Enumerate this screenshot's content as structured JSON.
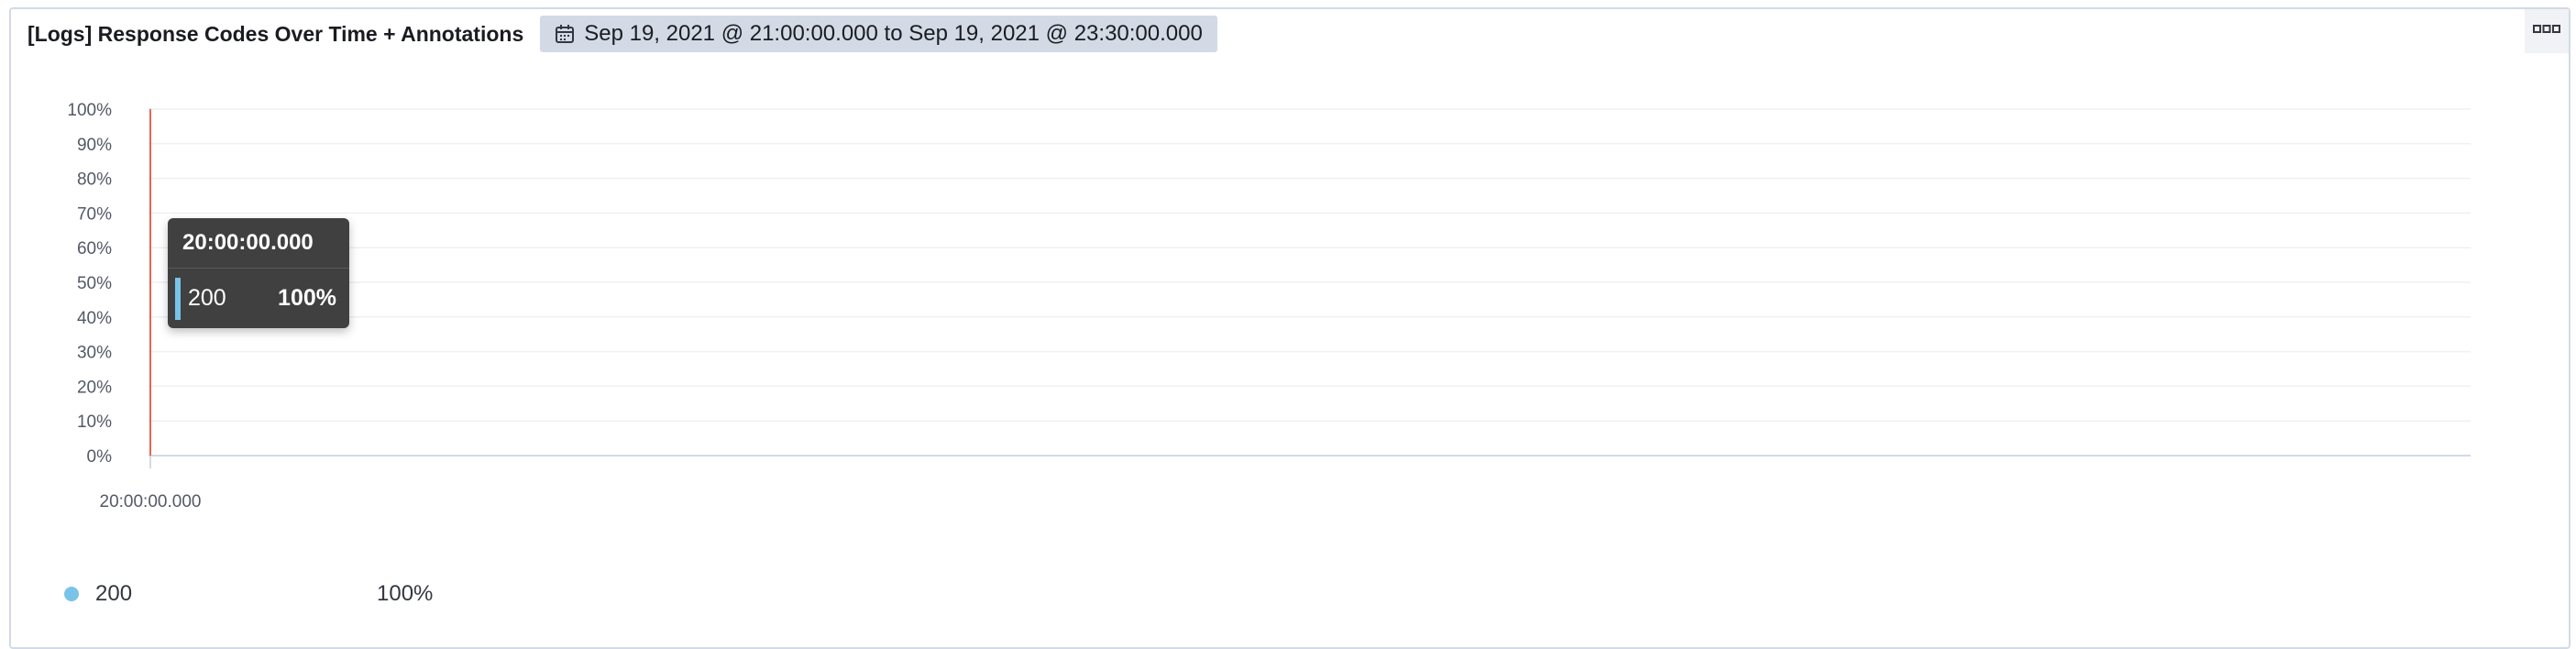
{
  "panel": {
    "title": "[Logs] Response Codes Over Time + Annotations",
    "time_range": "Sep 19, 2021 @ 21:00:00.000 to Sep 19, 2021 @ 23:30:00.000",
    "icons": {
      "calendar": "calendar-icon",
      "options": "panel-options-icon"
    }
  },
  "chart_data": {
    "type": "area",
    "title": "[Logs] Response Codes Over Time + Annotations",
    "xlabel": "",
    "ylabel": "",
    "y_ticks": [
      "0%",
      "10%",
      "20%",
      "30%",
      "40%",
      "50%",
      "60%",
      "70%",
      "80%",
      "90%",
      "100%"
    ],
    "ylim": [
      0,
      100
    ],
    "x_ticks": [
      "20:00:00.000"
    ],
    "series": [
      {
        "name": "200",
        "color": "#79c3e8",
        "x": [
          "20:00:00.000"
        ],
        "values": [
          100
        ]
      }
    ],
    "annotation_color": "#e7664c",
    "grid": true,
    "legend_position": "bottom-left"
  },
  "tooltip": {
    "title": "20:00:00.000",
    "series": "200",
    "value": "100%"
  },
  "legend": {
    "items": [
      {
        "label": "200",
        "value": "100%",
        "color": "#79c3e8"
      }
    ]
  }
}
